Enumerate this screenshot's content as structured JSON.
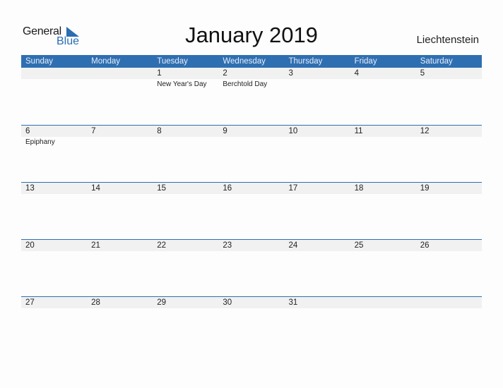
{
  "logo": {
    "line1": "General",
    "line2": "Blue"
  },
  "title": "January 2019",
  "country": "Liechtenstein",
  "colors": {
    "accent": "#2e6fb2",
    "row_bg": "#f1f1f1"
  },
  "weekdays": [
    "Sunday",
    "Monday",
    "Tuesday",
    "Wednesday",
    "Thursday",
    "Friday",
    "Saturday"
  ],
  "weeks": [
    {
      "days": [
        "",
        "",
        "1",
        "2",
        "3",
        "4",
        "5"
      ],
      "holidays": [
        "",
        "",
        "New Year's Day",
        "Berchtold Day",
        "",
        "",
        ""
      ]
    },
    {
      "days": [
        "6",
        "7",
        "8",
        "9",
        "10",
        "11",
        "12"
      ],
      "holidays": [
        "Epiphany",
        "",
        "",
        "",
        "",
        "",
        ""
      ]
    },
    {
      "days": [
        "13",
        "14",
        "15",
        "16",
        "17",
        "18",
        "19"
      ],
      "holidays": [
        "",
        "",
        "",
        "",
        "",
        "",
        ""
      ]
    },
    {
      "days": [
        "20",
        "21",
        "22",
        "23",
        "24",
        "25",
        "26"
      ],
      "holidays": [
        "",
        "",
        "",
        "",
        "",
        "",
        ""
      ]
    },
    {
      "days": [
        "27",
        "28",
        "29",
        "30",
        "31",
        "",
        ""
      ],
      "holidays": [
        "",
        "",
        "",
        "",
        "",
        "",
        ""
      ]
    }
  ]
}
